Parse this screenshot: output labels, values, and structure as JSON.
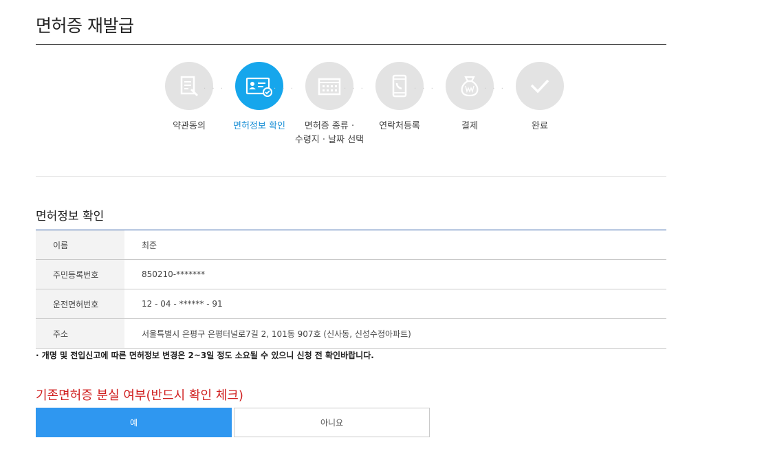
{
  "page": {
    "title": "면허증 재발급"
  },
  "steps": [
    {
      "label": "약관동의",
      "icon": "document-icon",
      "active": false
    },
    {
      "label": "면허정보 확인",
      "icon": "id-card-icon",
      "active": true
    },
    {
      "label": "면허증 종류 · 수령지 · 날짜 선택",
      "line1": "면허증 종류 ·",
      "line2": "수령지 · 날짜 선택",
      "icon": "calendar-icon",
      "active": false
    },
    {
      "label": "연락처등록",
      "icon": "phone-icon",
      "active": false
    },
    {
      "label": "결제",
      "icon": "money-bag-icon",
      "active": false
    },
    {
      "label": "완료",
      "icon": "check-icon",
      "active": false
    }
  ],
  "step_dots": "· · ·",
  "license_section": {
    "title": "면허정보 확인",
    "rows": [
      {
        "label": "이름",
        "value": "최준"
      },
      {
        "label": "주민등록번호",
        "value": "850210-*******"
      },
      {
        "label": "운전면허번호",
        "value": "12 - 04 - ****** - 91"
      },
      {
        "label": "주소",
        "value": "서울특별시 은평구 은평터널로7길 2, 101동 907호 (신사동, 신성수정아파트)"
      }
    ],
    "notice": "· 개명 및 전입신고에 따른 면허정보 변경은 2~3일 정도 소요될 수 있으니 신청 전 확인바랍니다."
  },
  "lost_section": {
    "title": "기존면허증 분실 여부(반드시 확인 체크)",
    "yes_label": "예",
    "no_label": "아니요"
  },
  "colors": {
    "accent": "#16a6ec",
    "button_blue": "#2f97f0",
    "warning_red": "#d01f1f",
    "step_inactive": "#e3e3e3"
  }
}
